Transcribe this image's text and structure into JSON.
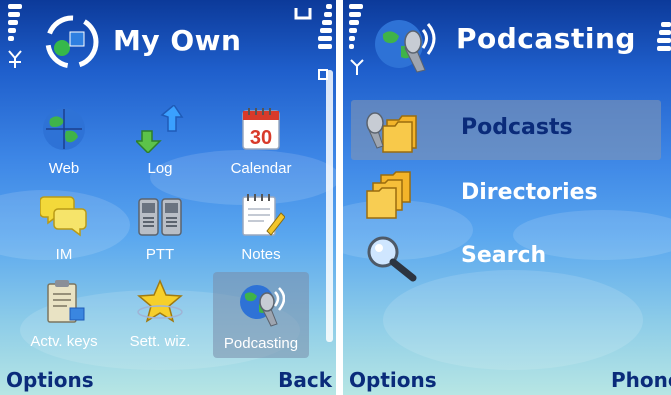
{
  "left_screen": {
    "title": "My Own",
    "grid": [
      {
        "label": "Web",
        "icon": "globe-icon"
      },
      {
        "label": "Log",
        "icon": "log-arrows-icon"
      },
      {
        "label": "Calendar",
        "icon": "calendar-icon",
        "day": "30"
      },
      {
        "label": "IM",
        "icon": "chat-bubbles-icon"
      },
      {
        "label": "PTT",
        "icon": "walkie-talkie-icon"
      },
      {
        "label": "Notes",
        "icon": "notepad-icon"
      },
      {
        "label": "Actv. keys",
        "icon": "clipboard-icon"
      },
      {
        "label": "Sett. wiz.",
        "icon": "star-icon"
      },
      {
        "label": "Podcasting",
        "icon": "podcast-globe-icon",
        "selected": true
      }
    ],
    "softkeys": {
      "left": "Options",
      "right": "Back"
    }
  },
  "right_screen": {
    "title": "Podcasting",
    "items": [
      {
        "label": "Podcasts",
        "icon": "podcast-folders-icon",
        "selected": true
      },
      {
        "label": "Directories",
        "icon": "folders-icon"
      },
      {
        "label": "Search",
        "icon": "magnifier-icon"
      }
    ],
    "softkeys": {
      "left": "Options",
      "right": "Phone"
    }
  },
  "colors": {
    "title_text": "#ffffff",
    "softkey_text": "#0a2b7a",
    "list_text": "#0a2b7a",
    "highlight": "#8296b4"
  }
}
